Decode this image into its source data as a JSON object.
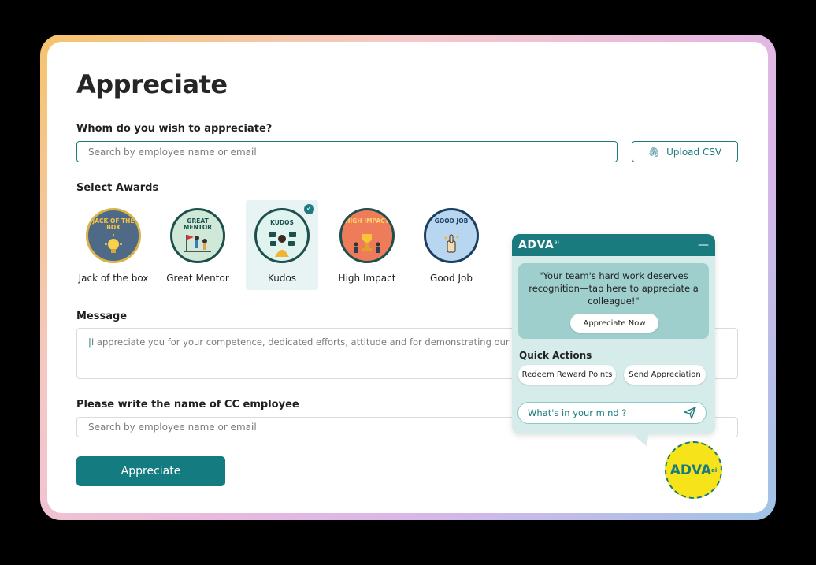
{
  "page": {
    "title": "Appreciate"
  },
  "recipient": {
    "label": "Whom do you wish to appreciate?",
    "placeholder": "Search by employee name or email",
    "upload_label": "Upload CSV"
  },
  "awards": {
    "label": "Select Awards",
    "items": [
      {
        "name": "Jack of the box",
        "badge_text": "JACK OF THE BOX",
        "bg": "#4f6a86",
        "text_color": "#f5c542",
        "ring": "#d9b44a",
        "selected": false
      },
      {
        "name": "Great Mentor",
        "badge_text": "GREAT MENTOR",
        "bg": "#cfe8d8",
        "text_color": "#1d4f4d",
        "ring": "#1d4f4d",
        "selected": false
      },
      {
        "name": "Kudos",
        "badge_text": "KUDOS",
        "bg": "#dff3ef",
        "text_color": "#1d4f4d",
        "ring": "#1d4f4d",
        "selected": true
      },
      {
        "name": "High Impact",
        "badge_text": "HIGH IMPACT",
        "bg": "#ee7c5a",
        "text_color": "#ffd36b",
        "ring": "#1d4f4d",
        "selected": false
      },
      {
        "name": "Good Job",
        "badge_text": "GOOD JOB",
        "bg": "#b8d6ef",
        "text_color": "#1d3f5f",
        "ring": "#1d3f5f",
        "selected": false
      }
    ]
  },
  "message": {
    "label": "Message",
    "text": "I appreciate you for your competence, dedicated efforts, attitude and for demonstrating our values."
  },
  "cc": {
    "label": "Please write the name of CC employee",
    "placeholder": "Search by employee name or email"
  },
  "submit_label": "Appreciate",
  "chatbot": {
    "brand": "ADVA",
    "brand_sup": "ai",
    "minimize": "—",
    "prompt": "\"Your team's hard work deserves recognition—tap here to appreciate a colleague!\"",
    "prompt_button": "Appreciate Now",
    "quick_actions_title": "Quick Actions",
    "quick_actions": [
      "Redeem Reward Points",
      "Send Appreciation"
    ],
    "input_placeholder": "What's in your mind ?",
    "badge_text": "ADVA",
    "badge_sup": "ai"
  },
  "colors": {
    "primary": "#147b80",
    "chat_bg": "#d5ecea",
    "badge_yellow": "#f7e31a"
  }
}
